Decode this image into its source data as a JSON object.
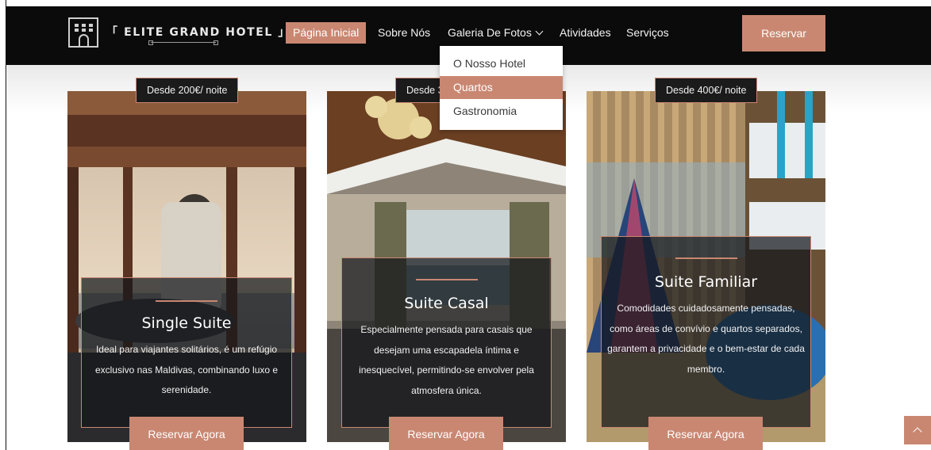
{
  "brand": {
    "name": "「 ELITE GRAND HOTEL 」"
  },
  "nav": {
    "items": [
      {
        "label": "Página Inicial",
        "active": true
      },
      {
        "label": "Sobre Nós"
      },
      {
        "label": "Galeria De Fotos",
        "dropdown": true
      },
      {
        "label": "Atividades"
      },
      {
        "label": "Serviços"
      }
    ],
    "cta": "Reservar"
  },
  "dropdown": {
    "items": [
      {
        "label": "O Nosso Hotel"
      },
      {
        "label": "Quartos",
        "active": true
      },
      {
        "label": "Gastronomia"
      }
    ]
  },
  "rooms": [
    {
      "price": "Desde 200€/ noite",
      "title": "Single Suite",
      "description": "Ideal para viajantes solitários, é um refúgio exclusivo nas Maldivas, combinando luxo e serenidade.",
      "button": "Reservar Agora"
    },
    {
      "price": "Desde 3",
      "title": "Suite Casal",
      "description": "Especialmente pensada para casais que desejam uma escapadela íntima e inesquecível, permitindo-se envolver pela atmosfera única.",
      "button": "Reservar Agora"
    },
    {
      "price": "Desde 400€/ noite",
      "title": "Suite Familiar",
      "description": "Comodidades cuidadosamente pensadas, como áreas de convívio e quartos separados, garantem a privacidade e o bem-estar de cada membro.",
      "button": "Reservar Agora"
    }
  ],
  "colors": {
    "accent": "#c98772",
    "nav_bg": "#0b0b0b"
  },
  "icons": {
    "logo": "hotel-building-icon",
    "dropdown": "chevron-down-icon",
    "scroll_top": "chevron-up-icon"
  }
}
